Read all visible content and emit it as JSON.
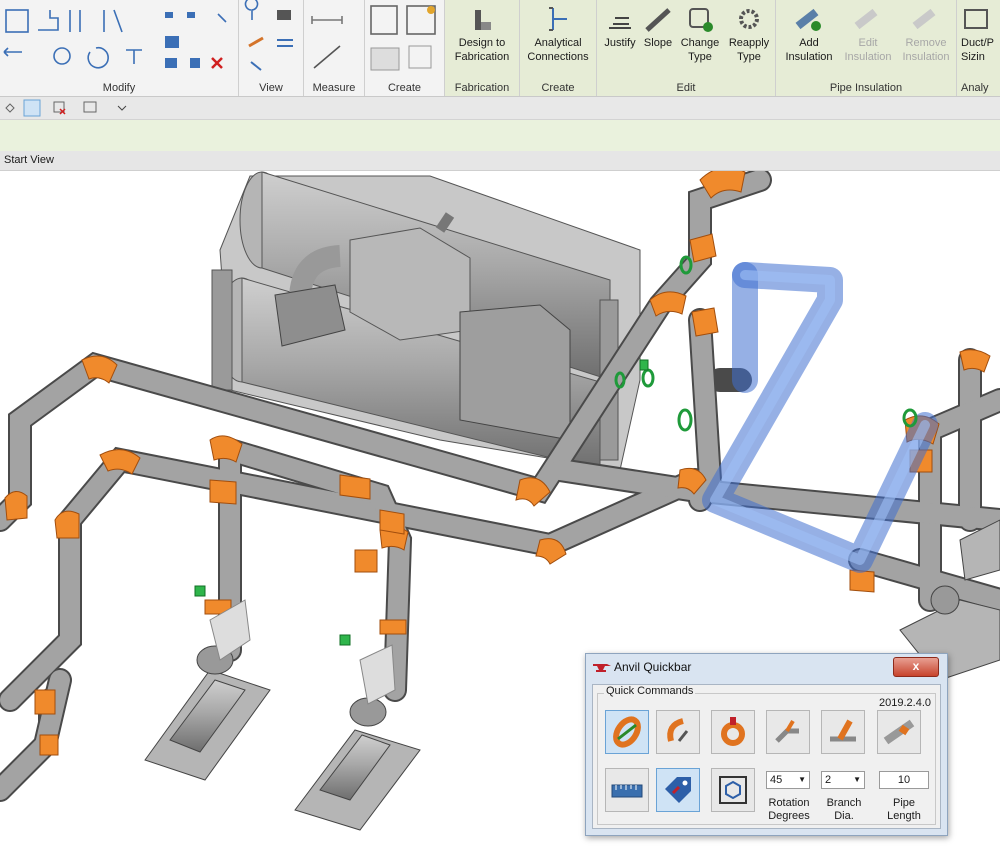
{
  "ribbon": {
    "panels": {
      "modify": "Modify",
      "view": "View",
      "measure": "Measure",
      "create": "Create",
      "fabrication": "Fabrication",
      "create2": "Create",
      "edit": "Edit",
      "pipe_insulation": "Pipe Insulation",
      "analysis": "Analy"
    },
    "buttons": {
      "design_to_fab_1": "Design to",
      "design_to_fab_2": "Fabrication",
      "analytical_1": "Analytical",
      "analytical_2": "Connections",
      "justify": "Justify",
      "slope": "Slope",
      "change_type_1": "Change",
      "change_type_2": "Type",
      "reapply_1": "Reapply",
      "reapply_2": "Type",
      "add_ins_1": "Add",
      "add_ins_2": "Insulation",
      "edit_ins_1": "Edit",
      "edit_ins_2": "Insulation",
      "remove_ins_1": "Remove",
      "remove_ins_2": "Insulation",
      "duct_sizing_1": "Duct/P",
      "duct_sizing_2": "Sizin"
    }
  },
  "view_tab": "Start View",
  "quickbar": {
    "title": "Anvil Quickbar",
    "close": "x",
    "group_label": "Quick Commands",
    "version": "2019.2.4.0",
    "rotation_value": "45",
    "branch_value": "2",
    "pipe_length_value": "10",
    "rotation_label_1": "Rotation",
    "rotation_label_2": "Degrees",
    "branch_label_1": "Branch",
    "branch_label_2": "Dia.",
    "pipe_label_1": "Pipe",
    "pipe_label_2": "Length"
  },
  "colors": {
    "pipe_gray": "#9a9a9a",
    "fitting_orange": "#f08a2c",
    "selected_blue": "#5a8fe6",
    "valve_green": "#1f9a3a"
  }
}
